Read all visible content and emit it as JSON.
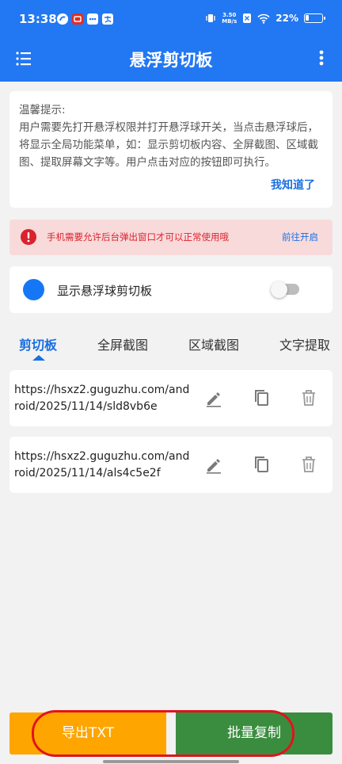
{
  "status_bar": {
    "time": "13:38",
    "net_speed_value": "3.50",
    "net_speed_unit": "MB/s",
    "battery": "22%",
    "battery_level": 0.22,
    "notification_icons": [
      "app-icon",
      "pinduoduo-icon",
      "chat-icon",
      "alipay-icon"
    ]
  },
  "app_bar": {
    "title": "悬浮剪切板",
    "left_icon": "menu-icon",
    "right_icon": "more-vertical-icon"
  },
  "tip": {
    "title": "温馨提示:",
    "body": "用户需要先打开悬浮权限并打开悬浮球开关，当点击悬浮球后，将显示全局功能菜单，如：显示剪切板内容、全屏截图、区域截图、提取屏幕文字等。用户点击对应的按钮即可执行。",
    "confirm": "我知道了"
  },
  "warning": {
    "text": "手机需要允许后台弹出窗口才可以正常使用哦",
    "link": "前往开启",
    "color": "#d9232d"
  },
  "floating_toggle": {
    "label": "显示悬浮球剪切板",
    "enabled": false
  },
  "tabs": [
    {
      "label": "剪切板",
      "active": true
    },
    {
      "label": "全屏截图",
      "active": false
    },
    {
      "label": "区域截图",
      "active": false
    },
    {
      "label": "文字提取",
      "active": false
    }
  ],
  "clips": [
    {
      "text": "https://hsxz2.guguzhu.com/android/2025/11/14/sld8vb6e"
    },
    {
      "text": "https://hsxz2.guguzhu.com/android/2025/11/14/als4c5e2f"
    }
  ],
  "clip_actions": [
    "edit-icon",
    "copy-icon",
    "delete-icon"
  ],
  "buttons": {
    "export": "导出TXT",
    "batch_copy": "批量复制"
  },
  "colors": {
    "primary": "#2277f3",
    "export_button": "#ffa500",
    "copy_button": "#3a8d3e",
    "highlight_ring": "#e0141e"
  }
}
